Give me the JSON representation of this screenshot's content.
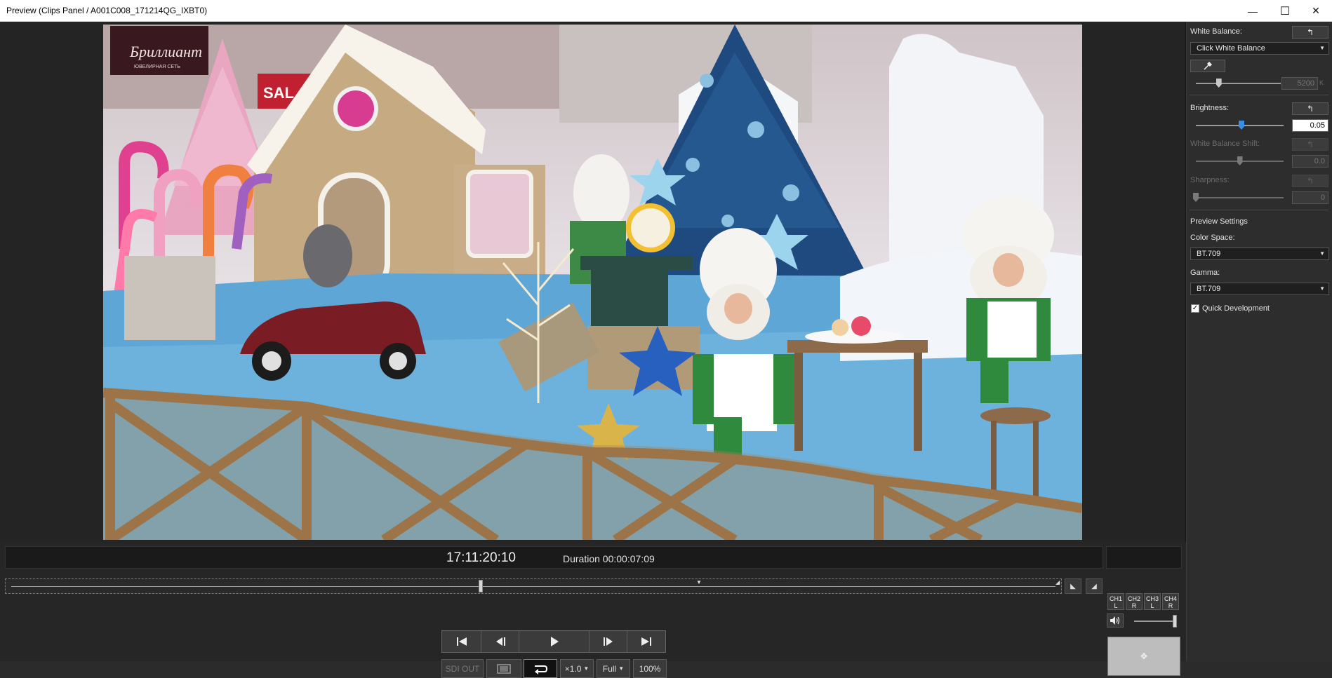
{
  "window": {
    "title": "Preview (Clips Panel / A001C008_171214QG_IXBT0)",
    "minimize": "—",
    "maximize": "☐",
    "close": "✕"
  },
  "image": {
    "sign_text": "Бриллиант",
    "sign_sub": "ЮВЕЛИРНАЯ СЕТЬ",
    "sale_text": "SAL"
  },
  "panel": {
    "white_balance": {
      "label": "White Balance:",
      "reset": "↰",
      "dropdown": "Click White Balance",
      "kelvin": "5200",
      "kelvin_unit": "K",
      "slider_fraction": 0.27
    },
    "brightness": {
      "label": "Brightness:",
      "reset": "↰",
      "value": "0.05",
      "slider_fraction": 0.52
    },
    "white_balance_shift": {
      "label": "White Balance Shift:",
      "reset": "↰",
      "value": "0.0",
      "slider_fraction": 0.5
    },
    "sharpness": {
      "label": "Sharpness:",
      "reset": "↰",
      "value": "0",
      "slider_fraction": 0.0
    },
    "preview_settings": {
      "label": "Preview Settings",
      "color_space_label": "Color Space:",
      "color_space": "BT.709",
      "gamma_label": "Gamma:",
      "gamma": "BT.709",
      "quick_dev_label": "Quick Development",
      "quick_dev_checked": "✓"
    }
  },
  "controls": {
    "timecode": "17:11:20:10",
    "duration": "Duration 00:00:07:09",
    "playhead_fraction": 0.449,
    "sdi_out": "SDI OUT",
    "speed": "×1.0",
    "quality": "Full",
    "zoom": "100%",
    "channels": [
      {
        "top": "CH1",
        "bottom": "L"
      },
      {
        "top": "CH2",
        "bottom": "R"
      },
      {
        "top": "CH3",
        "bottom": "L"
      },
      {
        "top": "CH4",
        "bottom": "R"
      }
    ],
    "jog": "✥"
  }
}
